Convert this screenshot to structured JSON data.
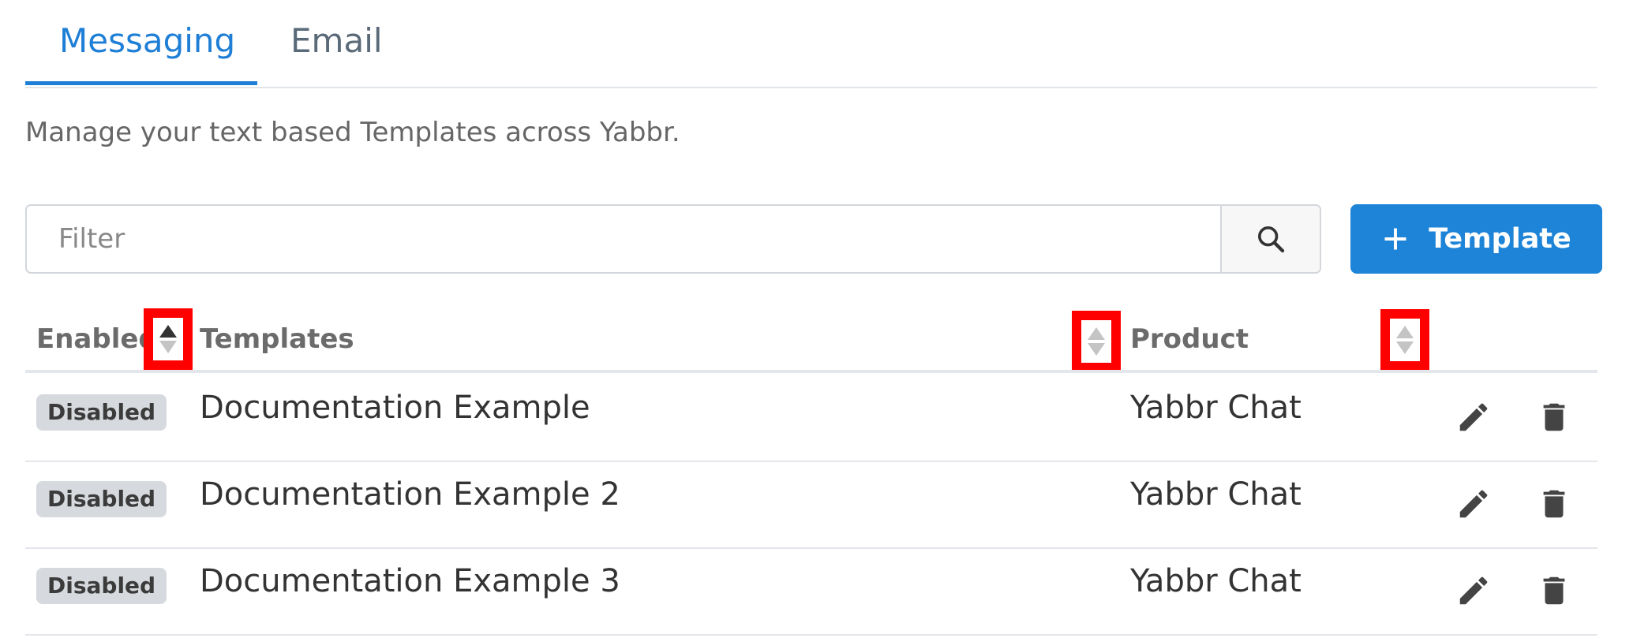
{
  "tabs": [
    {
      "label": "Messaging",
      "active": true
    },
    {
      "label": "Email",
      "active": false
    }
  ],
  "description": "Manage your text based Templates across Yabbr.",
  "filter": {
    "placeholder": "Filter",
    "value": ""
  },
  "add_button": {
    "label": "Template",
    "icon": "plus-icon"
  },
  "table": {
    "columns": [
      "Enabled",
      "Templates",
      "Product"
    ],
    "rows": [
      {
        "status": "Disabled",
        "template": "Documentation Example",
        "product": "Yabbr Chat"
      },
      {
        "status": "Disabled",
        "template": "Documentation Example 2",
        "product": "Yabbr Chat"
      },
      {
        "status": "Disabled",
        "template": "Documentation Example 3",
        "product": "Yabbr Chat"
      }
    ]
  },
  "colors": {
    "accent": "#1f7fd6",
    "highlight": "#ff0000",
    "badge_bg": "#d6d9dd"
  }
}
